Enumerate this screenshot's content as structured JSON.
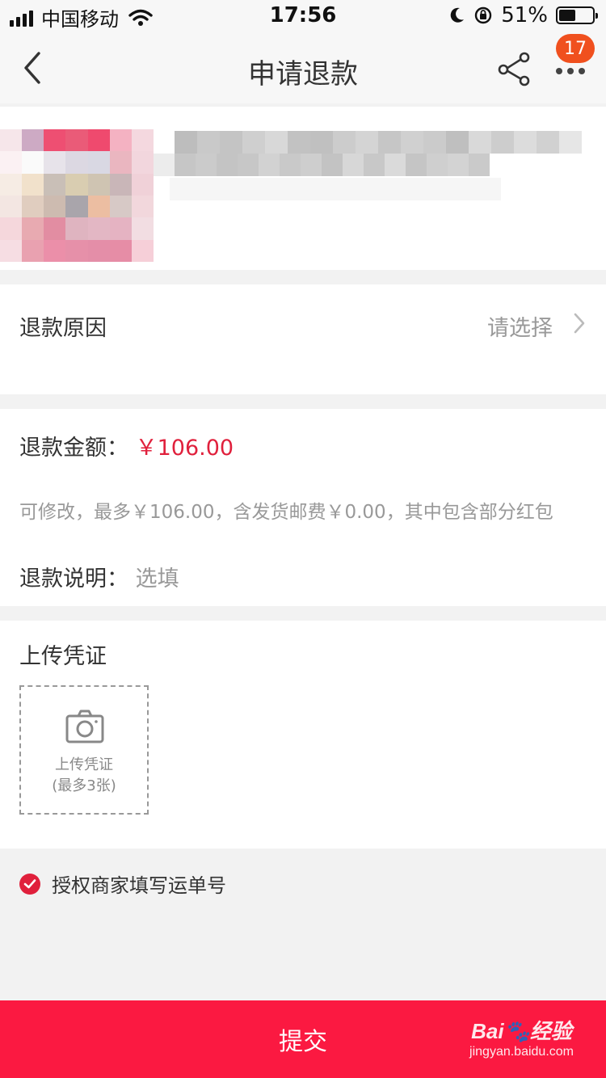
{
  "status_bar": {
    "carrier": "中国移动",
    "time": "17:56",
    "battery_text": "51%",
    "battery_level": 0.51
  },
  "nav": {
    "title": "申请退款",
    "notification_count": "17"
  },
  "refund_reason": {
    "label": "退款原因",
    "placeholder": "请选择"
  },
  "refund_amount": {
    "label": "退款金额：",
    "value": "￥106.00",
    "hint": "可修改，最多￥106.00，含发货邮费￥0.00，其中包含部分红包"
  },
  "refund_note": {
    "label": "退款说明：",
    "placeholder": "选填"
  },
  "upload": {
    "title": "上传凭证",
    "button_line1": "上传凭证",
    "button_line2": "(最多3张)"
  },
  "authorize": {
    "label": "授权商家填写运单号",
    "checked": true
  },
  "submit_label": "提交",
  "watermark": {
    "brand": "Bai🐾经验",
    "url": "jingyan.baidu.com"
  },
  "colors": {
    "accent": "#fb1941",
    "price": "#e0203c",
    "badge": "#f0501e"
  }
}
